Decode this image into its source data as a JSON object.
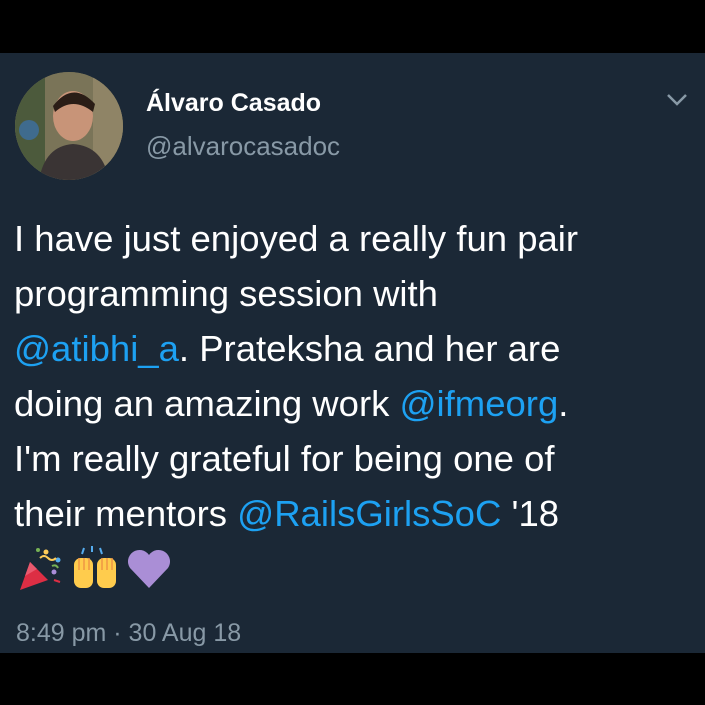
{
  "author": {
    "name": "Álvaro Casado",
    "handle": "@alvarocasadoc"
  },
  "tweet": {
    "lines": [
      [
        {
          "text": "I have just enjoyed a really fun pair"
        }
      ],
      [
        {
          "text": "programming session with"
        }
      ],
      [
        {
          "text": "@atibhi_a",
          "mention": true
        },
        {
          "text": ".  Prateksha and her are"
        }
      ],
      [
        {
          "text": "doing an amazing work "
        },
        {
          "text": "@ifmeorg",
          "mention": true
        },
        {
          "text": "."
        }
      ],
      [
        {
          "text": "I'm really grateful for being one of"
        }
      ],
      [
        {
          "text": "their mentors  "
        },
        {
          "text": "@RailsGirlsSoC",
          "mention": true
        },
        {
          "text": " '18"
        }
      ]
    ],
    "emojis": [
      "party-popper-emoji",
      "raising-hands-emoji",
      "purple-heart-emoji"
    ],
    "timestamp": "8:49 pm · 30 Aug 18"
  },
  "colors": {
    "background": "#1b2836",
    "text": "#ffffff",
    "secondary_text": "#8899a6",
    "mention": "#1da1f2"
  },
  "icons": {
    "menu": "chevron-down-icon"
  }
}
